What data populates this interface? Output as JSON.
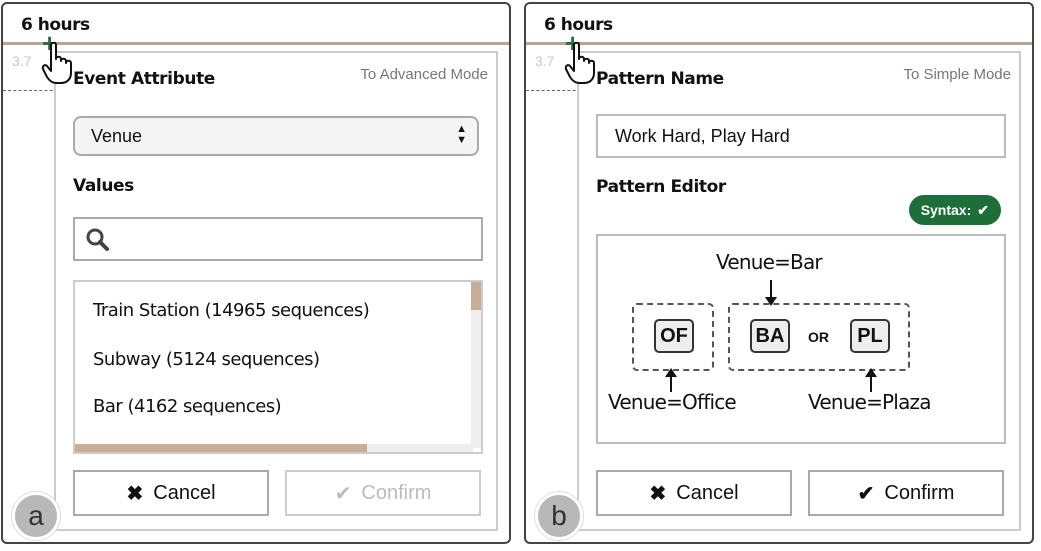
{
  "panel_a": {
    "hours": "6 hours",
    "small_value": "3.7",
    "mode_link": "To Advanced Mode",
    "event_attribute_label": "Event Attribute",
    "selected_attribute": "Venue",
    "values_label": "Values",
    "search_placeholder": "",
    "list_items": [
      "Train Station (14965 sequences)",
      "Subway (5124 sequences)",
      "Bar (4162 sequences)"
    ],
    "cancel_label": "Cancel",
    "confirm_label": "Confirm",
    "badge": "a"
  },
  "panel_b": {
    "hours": "6 hours",
    "small_value": "3.7",
    "mode_link": "To Simple Mode",
    "pattern_name_label": "Pattern Name",
    "pattern_name_value": "Work Hard, Play Hard",
    "pattern_editor_label": "Pattern Editor",
    "syntax_label": "Syntax:",
    "tokens": [
      "OF",
      "BA",
      "PL"
    ],
    "or_label": "OR",
    "annotations": {
      "top": "Venue=Bar",
      "left": "Venue=Office",
      "right": "Venue=Plaza"
    },
    "cancel_label": "Cancel",
    "confirm_label": "Confirm",
    "badge": "b"
  },
  "colors": {
    "timeline": "#b9a493",
    "plus": "#2e6b45",
    "syntax_badge": "#1e6e3a",
    "scroll_thumb": "#c8ad98"
  },
  "icons": [
    "plus-icon",
    "pointer-hand-icon",
    "search-icon",
    "close-icon",
    "check-icon",
    "select-arrows-icon"
  ]
}
